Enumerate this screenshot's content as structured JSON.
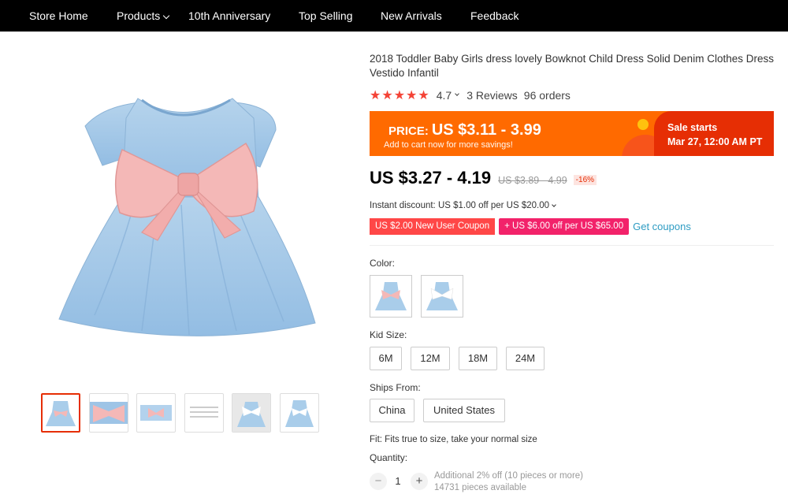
{
  "nav": {
    "items": [
      {
        "label": "Store Home"
      },
      {
        "label": "Products"
      },
      {
        "label": "10th Anniversary"
      },
      {
        "label": "Top Selling"
      },
      {
        "label": "New Arrivals"
      },
      {
        "label": "Feedback"
      }
    ]
  },
  "product": {
    "title": "2018 Toddler Baby Girls dress lovely Bowknot Child Dress Solid Denim Clothes Dress Vestido Infantil",
    "rating_value": "4.7",
    "reviews": "3 Reviews",
    "orders": "96 orders",
    "star_count": 5
  },
  "promo": {
    "price_label": "PRICE:",
    "price_range": "US $3.11 - 3.99",
    "subtext": "Add to cart now for more savings!",
    "sale_line1": "Sale starts",
    "sale_line2": "Mar 27, 12:00 AM PT",
    "colors": {
      "orange": "#ff6a00",
      "red": "#e62e04",
      "yellow": "#ffc20e"
    }
  },
  "price": {
    "current": "US $3.27 - 4.19",
    "original": "US $3.89 - 4.99",
    "discount": "-16%"
  },
  "instant_discount": "Instant discount: US $1.00 off per US $20.00",
  "coupons": {
    "new_user": "US $2.00 New User Coupon",
    "store": "+ US $6.00 off per US $65.00",
    "get_link": "Get coupons"
  },
  "color": {
    "label": "Color:",
    "swatches": [
      "pink bow",
      "white bow"
    ]
  },
  "size": {
    "label": "Kid Size:",
    "options": [
      "6M",
      "12M",
      "18M",
      "24M"
    ]
  },
  "ships_from": {
    "label": "Ships From:",
    "options": [
      "China",
      "United States"
    ]
  },
  "fit": "Fit: Fits true to size, take your normal size",
  "quantity": {
    "label": "Quantity:",
    "value": "1",
    "minus": "−",
    "plus": "+",
    "note1": "Additional 2% off (10 pieces or more)",
    "note2": "14731 pieces available"
  }
}
